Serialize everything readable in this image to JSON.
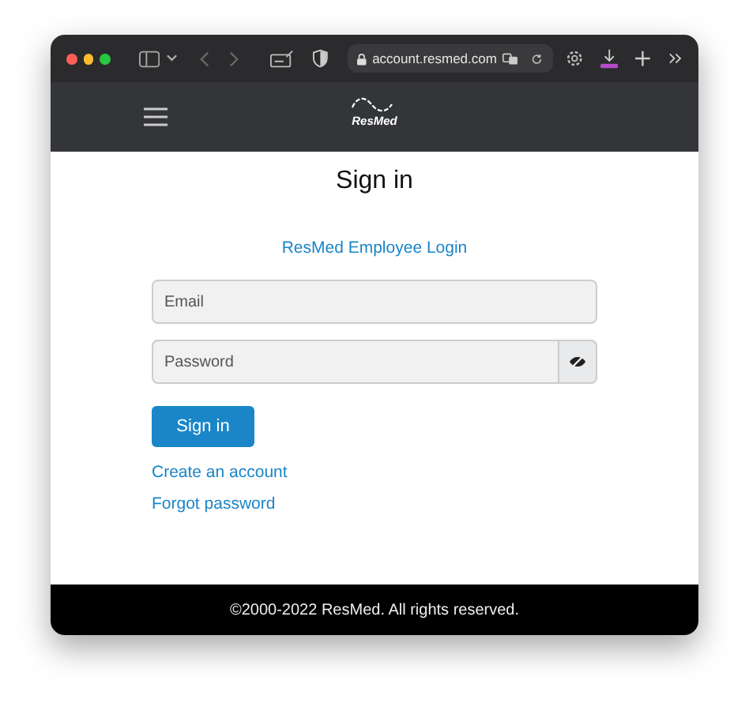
{
  "browser": {
    "url": "account.resmed.com"
  },
  "header": {
    "logo_text": "ResMed"
  },
  "title": "Sign in",
  "employee_link": "ResMed Employee Login",
  "email": {
    "placeholder": "Email"
  },
  "password": {
    "placeholder": "Password"
  },
  "submit": "Sign in",
  "links": [
    "Create an account",
    "Forgot password"
  ],
  "footer": "©2000-2022 ResMed. All rights reserved."
}
